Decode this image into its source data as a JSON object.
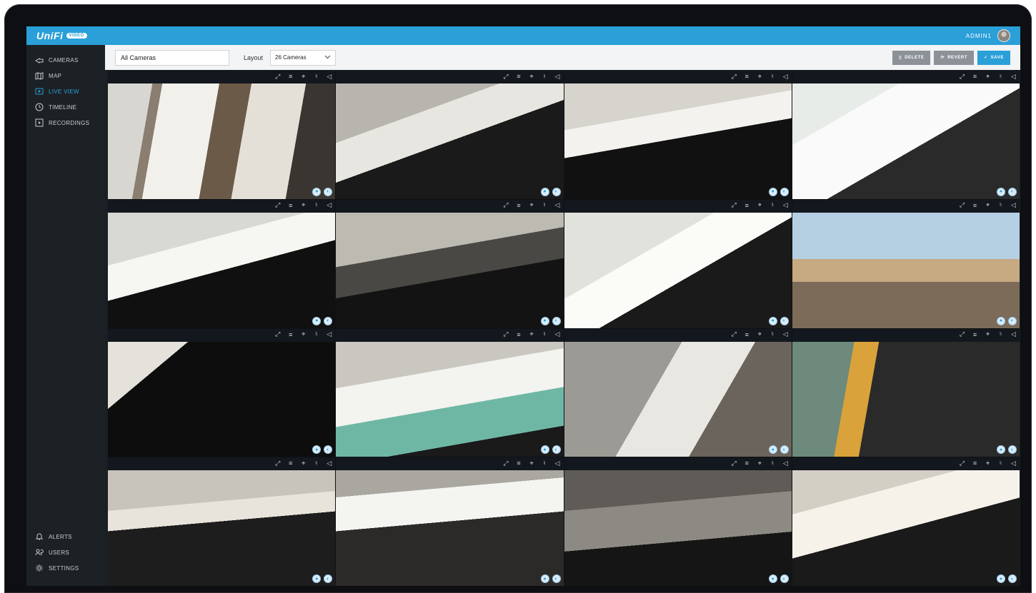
{
  "brand": {
    "name": "UniFi",
    "tag": "VIDEO"
  },
  "user": {
    "name": "ADMIN1"
  },
  "sidebar": {
    "items": [
      {
        "label": "CAMERAS",
        "icon": "camera-icon",
        "active": false
      },
      {
        "label": "MAP",
        "icon": "map-icon",
        "active": false
      },
      {
        "label": "LIVE VIEW",
        "icon": "live-view-icon",
        "active": true
      },
      {
        "label": "TIMELINE",
        "icon": "clock-icon",
        "active": false
      },
      {
        "label": "RECORDINGS",
        "icon": "play-icon",
        "active": false
      }
    ],
    "bottom_items": [
      {
        "label": "ALERTS",
        "icon": "bell-icon"
      },
      {
        "label": "USERS",
        "icon": "users-icon"
      },
      {
        "label": "SETTINGS",
        "icon": "gear-icon"
      }
    ]
  },
  "toolbar": {
    "view_name": "All Cameras",
    "layout_label": "Layout",
    "layout_value": "26 Cameras",
    "delete_label": "DELETE",
    "revert_label": "REVERT",
    "save_label": "SAVE"
  },
  "tiles": [
    {
      "scene": "hallway"
    },
    {
      "scene": "office-purple"
    },
    {
      "scene": "office-desk"
    },
    {
      "scene": "office-bright"
    },
    {
      "scene": "white-room"
    },
    {
      "scene": "workstation"
    },
    {
      "scene": "desk-overhead"
    },
    {
      "scene": "rooftop"
    },
    {
      "scene": "dark-floor"
    },
    {
      "scene": "cutting-table"
    },
    {
      "scene": "corner-room"
    },
    {
      "scene": "display-room"
    },
    {
      "scene": "open-office"
    },
    {
      "scene": "whiteboard-room"
    },
    {
      "scene": "lounge"
    },
    {
      "scene": "open-office-2"
    }
  ],
  "colors": {
    "accent": "#2a9fd8",
    "sidebar": "#1c2126",
    "toolbar": "#f3f4f5"
  }
}
